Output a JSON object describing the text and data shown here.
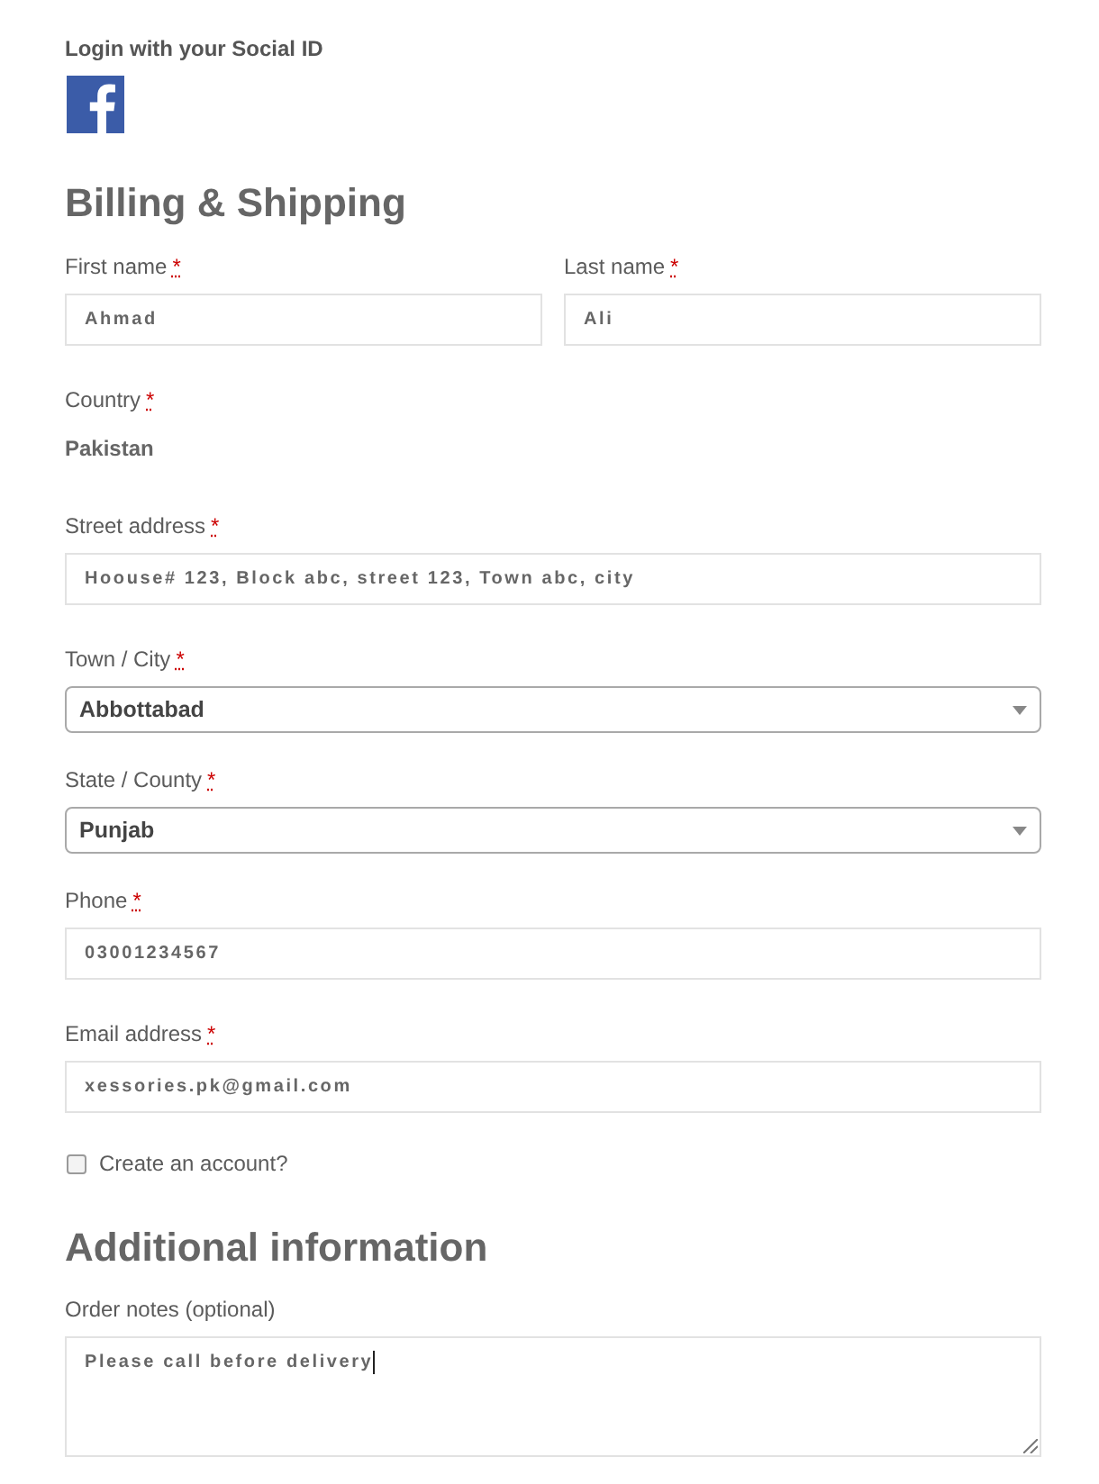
{
  "social_login": {
    "title": "Login with your Social ID"
  },
  "billing": {
    "title": "Billing & Shipping",
    "rows": [
      [
        {
          "kind": "text",
          "label": "First name",
          "required_mark": "*",
          "value": "Ahmad"
        },
        {
          "kind": "text",
          "label": "Last name",
          "required_mark": "*",
          "value": "Ali"
        }
      ],
      [
        {
          "kind": "static",
          "label": "Country",
          "required_mark": "*",
          "value": "Pakistan"
        }
      ],
      [
        {
          "kind": "text",
          "label": "Street address",
          "required_mark": "*",
          "value": "Hoouse# 123, Block abc, street 123, Town abc, city"
        }
      ],
      [
        {
          "kind": "select",
          "label": "Town / City",
          "required_mark": "*",
          "value": "Abbottabad"
        }
      ],
      [
        {
          "kind": "select",
          "label": "State / County",
          "required_mark": "*",
          "value": "Punjab"
        }
      ],
      [
        {
          "kind": "text",
          "label": "Phone",
          "required_mark": "*",
          "value": "03001234567"
        }
      ],
      [
        {
          "kind": "text",
          "label": "Email address",
          "required_mark": "*",
          "value": "xessories.pk@gmail.com"
        }
      ]
    ]
  },
  "create_account": {
    "label": "Create an account?",
    "checked": false
  },
  "additional": {
    "title": "Additional information",
    "fields": [
      {
        "kind": "textarea",
        "label": "Order notes (optional)",
        "value": "Please call before delivery",
        "focused": true
      }
    ]
  }
}
